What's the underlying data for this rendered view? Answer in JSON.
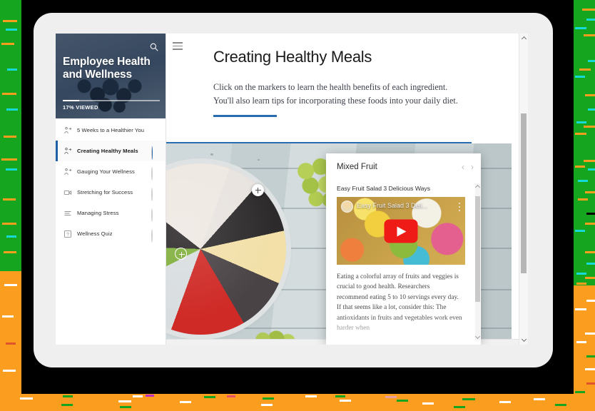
{
  "device": {
    "label": "tablet-frame"
  },
  "sidebar": {
    "hero": {
      "title": "Employee Health and Wellness",
      "progress_label": "17% VIEWED",
      "progress_percent": 17,
      "search_icon": "search-icon"
    },
    "items": [
      {
        "label": "5 Weeks to a Healthier You",
        "icon": "interaction-icon",
        "status": "complete",
        "active": false
      },
      {
        "label": "Creating Healthy Meals",
        "icon": "interaction-icon",
        "status": "in-progress",
        "active": true
      },
      {
        "label": "Gauging Your Wellness",
        "icon": "interaction-icon",
        "status": "not-started",
        "active": false
      },
      {
        "label": "Stretching for Success",
        "icon": "video-icon",
        "status": "not-started",
        "active": false
      },
      {
        "label": "Managing Stress",
        "icon": "list-icon",
        "status": "not-started",
        "active": false
      },
      {
        "label": "Wellness Quiz",
        "icon": "quiz-icon",
        "status": "not-started",
        "active": false
      }
    ]
  },
  "main": {
    "menu_icon": "hamburger-menu-icon",
    "title": "Creating Healthy Meals",
    "description": "Click on the markers to learn the health benefits of each ingredient. You'll also learn tips for incorporating these foods into your daily diet.",
    "markers": [
      {
        "name": "grapes-marker",
        "label": "+"
      },
      {
        "name": "bowl-marker",
        "label": "+"
      }
    ]
  },
  "popup": {
    "title": "Mixed Fruit",
    "prev_icon": "chevron-left-icon",
    "next_icon": "chevron-right-icon",
    "video_heading": "Easy Fruit Salad 3 Delicious Ways",
    "video_overlay_title": "Easy Fruit Salad 3 Deli...",
    "play_icon": "youtube-play-icon",
    "kebab_icon": "more-options-icon",
    "body_text": "Eating a colorful array of fruits and veggies is crucial to good health. Researchers recommend eating 5 to 10 servings every day. If that seems like a lot, consider this: The antioxidants in fruits and vegetables work even harder when"
  },
  "colors": {
    "accent_blue": "#1f5fa8",
    "rule_blue": "#2a6cb0",
    "confetti_green": "#16a51e",
    "confetti_orange": "#fb9e20",
    "youtube_red": "#ef1b16"
  }
}
